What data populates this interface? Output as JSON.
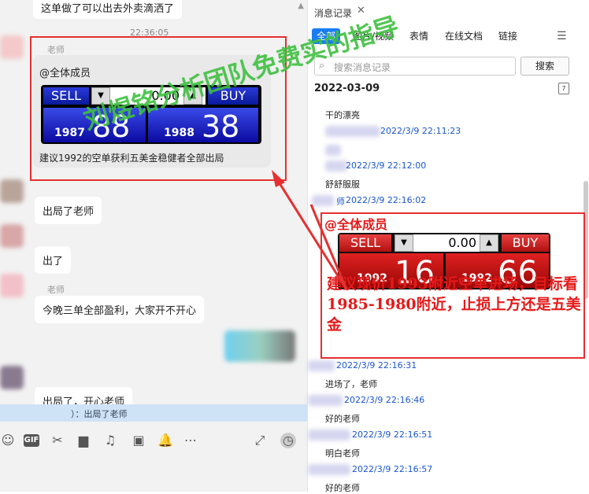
{
  "chat": {
    "top_message": "这单做了可以出去外卖滴洒了",
    "timestamp": "22:36:05",
    "sender_teacher": "老师",
    "card": {
      "title": "@全体成员",
      "sell_label": "SELL",
      "buy_label": "BUY",
      "mid_value": "0.00",
      "sell_small": "1987",
      "sell_big": "88",
      "buy_small": "1988",
      "buy_big": "38",
      "text": "建议1992的空单获利五美金稳健者全部出局"
    },
    "msg1": "出局了老师",
    "msg2": "出了",
    "msg3": "今晚三单全部盈利，大家开不开心",
    "msg4": "出局了，开心老师",
    "reply_preview": "）：出局了老师"
  },
  "panel": {
    "title": "消息记录",
    "tabs": [
      "全部",
      "图片/视频",
      "表情",
      "在线文档",
      "链接"
    ],
    "search_placeholder": "搜索消息记录",
    "search_button": "搜索",
    "date": "2022-03-09",
    "calendar_day": "7",
    "entries": [
      {
        "text": "干的漂亮",
        "time": "2022/3/9 22:11:23"
      },
      {
        "text": "",
        "time": "2022/3/9 22:12:00"
      },
      {
        "text": "舒舒服服",
        "time": "2022/3/9 22:16:02"
      },
      {
        "text": "进场了，老师",
        "time": "2022/3/9 22:16:31"
      },
      {
        "text": "好的老师",
        "time": "2022/3/9 22:16:46"
      },
      {
        "text": "明白老师",
        "time": "2022/3/9 22:16:51"
      },
      {
        "text": "好的老师",
        "time": "2022/3/9 22:16:57"
      }
    ],
    "teacher_suffix": "师"
  },
  "annotation": {
    "head": "@全体成员",
    "sell_label": "SELL",
    "buy_label": "BUY",
    "mid_value": "0.00",
    "sell_small": "1992",
    "sell_big": "16",
    "buy_small": "1992",
    "buy_big": "66",
    "text": "建议现价1993附近空单进场，目标看1985-1980附近，止损上方还是五美金"
  },
  "watermark": "刘煜铭分析团队免费实的指导"
}
